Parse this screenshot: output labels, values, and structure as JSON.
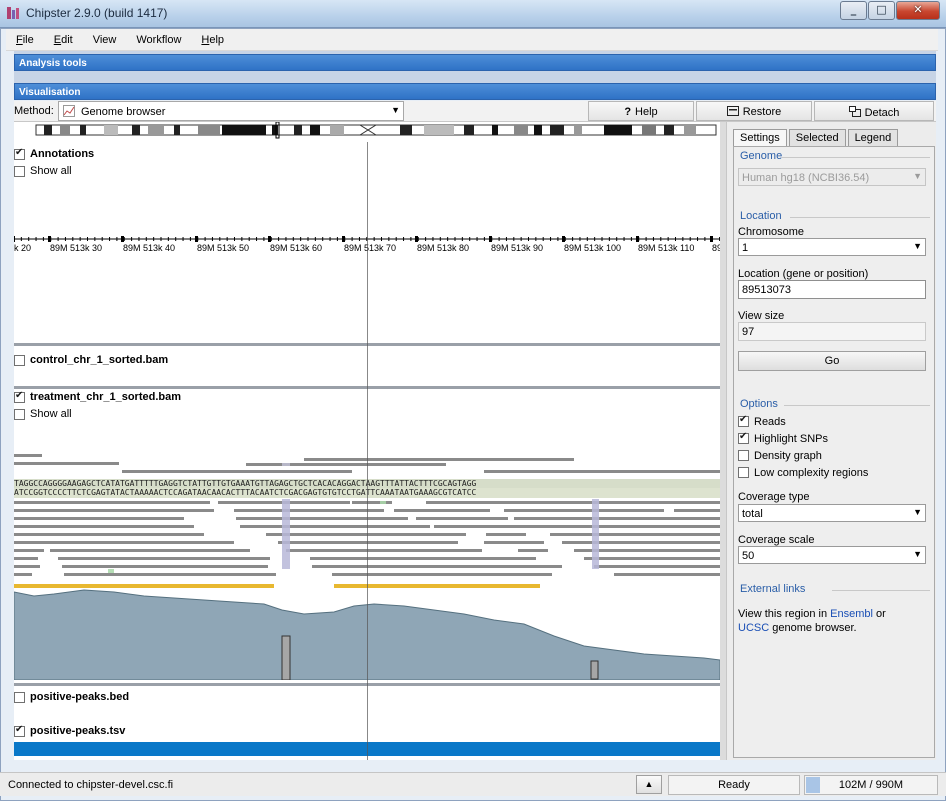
{
  "window": {
    "title": "Chipster 2.9.0 (build 1417)",
    "minimize_glyph": "_",
    "maximize_glyph": "□",
    "close_glyph": "✕"
  },
  "menu": {
    "items": [
      {
        "label": "File",
        "mnemonic": "F",
        "rest": "ile"
      },
      {
        "label": "Edit",
        "mnemonic": "E",
        "rest": "dit"
      },
      {
        "label": "View",
        "mnemonic": "",
        "rest": "View"
      },
      {
        "label": "Workflow",
        "mnemonic": "",
        "rest": "Workflow"
      },
      {
        "label": "Help",
        "mnemonic": "H",
        "rest": "elp"
      }
    ]
  },
  "panels": {
    "analysis_tools": "Analysis tools",
    "visualisation": "Visualisation"
  },
  "toolbar": {
    "method_label": "Method:",
    "method_value": "Genome browser",
    "help_icon": "?",
    "help_label": "Help",
    "restore_label": "Restore",
    "detach_label": "Detach"
  },
  "tracks": {
    "annotations": {
      "label": "Annotations",
      "checked": true,
      "show_all": "Show all",
      "show_all_checked": false
    },
    "control": {
      "label": "control_chr_1_sorted.bam",
      "checked": false
    },
    "treatment": {
      "label": "treatment_chr_1_sorted.bam",
      "checked": true,
      "show_all": "Show all",
      "show_all_checked": false
    },
    "peaks_bed": {
      "label": "positive-peaks.bed",
      "checked": false
    },
    "peaks_tsv": {
      "label": "positive-peaks.tsv",
      "checked": true
    }
  },
  "ruler_ticks": [
    "k 20",
    "89M 513k 30",
    "89M 513k 40",
    "89M 513k 50",
    "89M 513k 60",
    "89M 513k 70",
    "89M 513k 80",
    "89M 513k 90",
    "89M 513k 100",
    "89M 513k 110",
    "89"
  ],
  "sequence": {
    "forward": "TAGGCCAGGGGAAGAGCTCATATGATTTTTGAGGTCTATTGTTGTGAAATGTTAGAGCTGCTCACACAGGACTAAGTTTATTACTTTCGCAGTAGG",
    "reverse": "ATCCGGTCCCCTTCTCGAGTATACTAAAAACTCCAGATAACAACACTTTACAATCTCGACGAGTGTGTCCTGATTCAAATAATGAAAGCGTCATCC"
  },
  "settings": {
    "tabs": [
      "Settings",
      "Selected",
      "Legend"
    ],
    "active_tab": "Settings",
    "genome_title": "Genome",
    "genome_value": "Human hg18 (NCBI36.54)",
    "location_title": "Location",
    "chromosome_label": "Chromosome",
    "chromosome_value": "1",
    "location_label": "Location (gene or position)",
    "location_value": "89513073",
    "view_size_label": "View size",
    "view_size_value": "97",
    "go_label": "Go",
    "options_title": "Options",
    "options": [
      {
        "label": "Reads",
        "checked": true
      },
      {
        "label": "Highlight SNPs",
        "checked": true
      },
      {
        "label": "Density graph",
        "checked": false
      },
      {
        "label": "Low complexity regions",
        "checked": false
      }
    ],
    "coverage_type_label": "Coverage type",
    "coverage_type_value": "total",
    "coverage_scale_label": "Coverage scale",
    "coverage_scale_value": "50",
    "external_links_title": "External links",
    "ext_text_1": "View this region in",
    "ext_link_ensembl": "Ensembl",
    "ext_text_2": "or",
    "ext_link_ucsc": "UCSC",
    "ext_text_3": "genome browser."
  },
  "status": {
    "connection": "Connected to chipster-devel.csc.fi",
    "up_glyph": "▲",
    "state": "Ready",
    "memory": "102M / 990M"
  },
  "colors": {
    "accent_bar": "#2f72c6",
    "coverage_fill": "#8fa6b6",
    "read_gray": "#8a8a8a",
    "peak_blue": "#0a78c8",
    "gene_yellow": "#e8b830"
  }
}
